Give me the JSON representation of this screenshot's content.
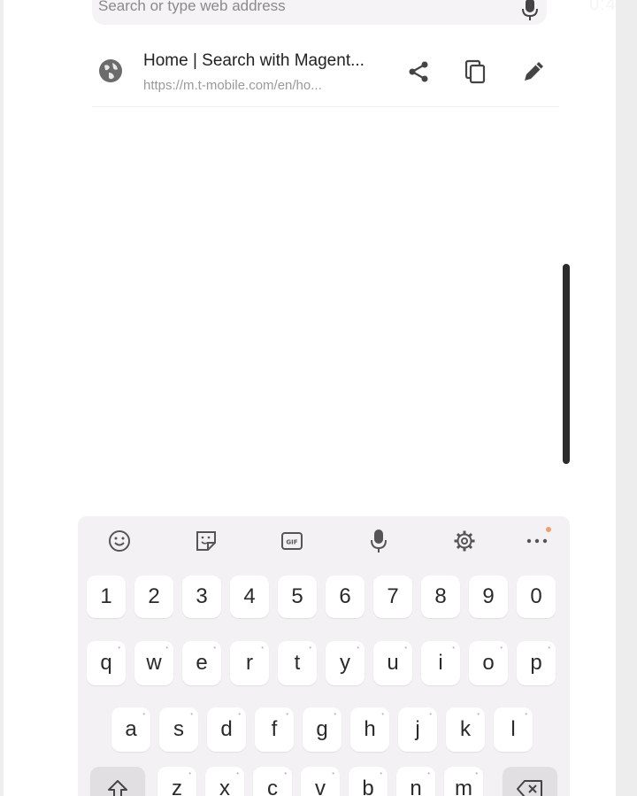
{
  "search": {
    "placeholder": "Search or type web address"
  },
  "status": {
    "time": "0:4"
  },
  "suggestion": {
    "title": "Home | Search with Magent...",
    "url": "https://m.t-mobile.com/en/ho..."
  },
  "icons": {
    "top_mic": "mic-icon",
    "globe": "globe-icon",
    "share": "share-icon",
    "copy": "copy-icon",
    "edit": "pencil-icon",
    "toolbar": [
      "emoji-icon",
      "sticker-icon",
      "gif-icon",
      "mic-icon",
      "settings-icon",
      "more-icon"
    ],
    "shift": "shift-icon",
    "backspace": "backspace-icon"
  },
  "keyboard": {
    "numbers": [
      "1",
      "2",
      "3",
      "4",
      "5",
      "6",
      "7",
      "8",
      "9",
      "0"
    ],
    "row1": [
      "q",
      "w",
      "e",
      "r",
      "t",
      "y",
      "u",
      "i",
      "o",
      "p"
    ],
    "row2": [
      "a",
      "s",
      "d",
      "f",
      "g",
      "h",
      "j",
      "k",
      "l"
    ],
    "row3": [
      "z",
      "x",
      "c",
      "v",
      "b",
      "n",
      "m"
    ]
  },
  "colors": {
    "keyboard_bg": "#f3f1f3",
    "key_bg": "#ffffff",
    "scroll_thumb": "#2c2c2c"
  }
}
